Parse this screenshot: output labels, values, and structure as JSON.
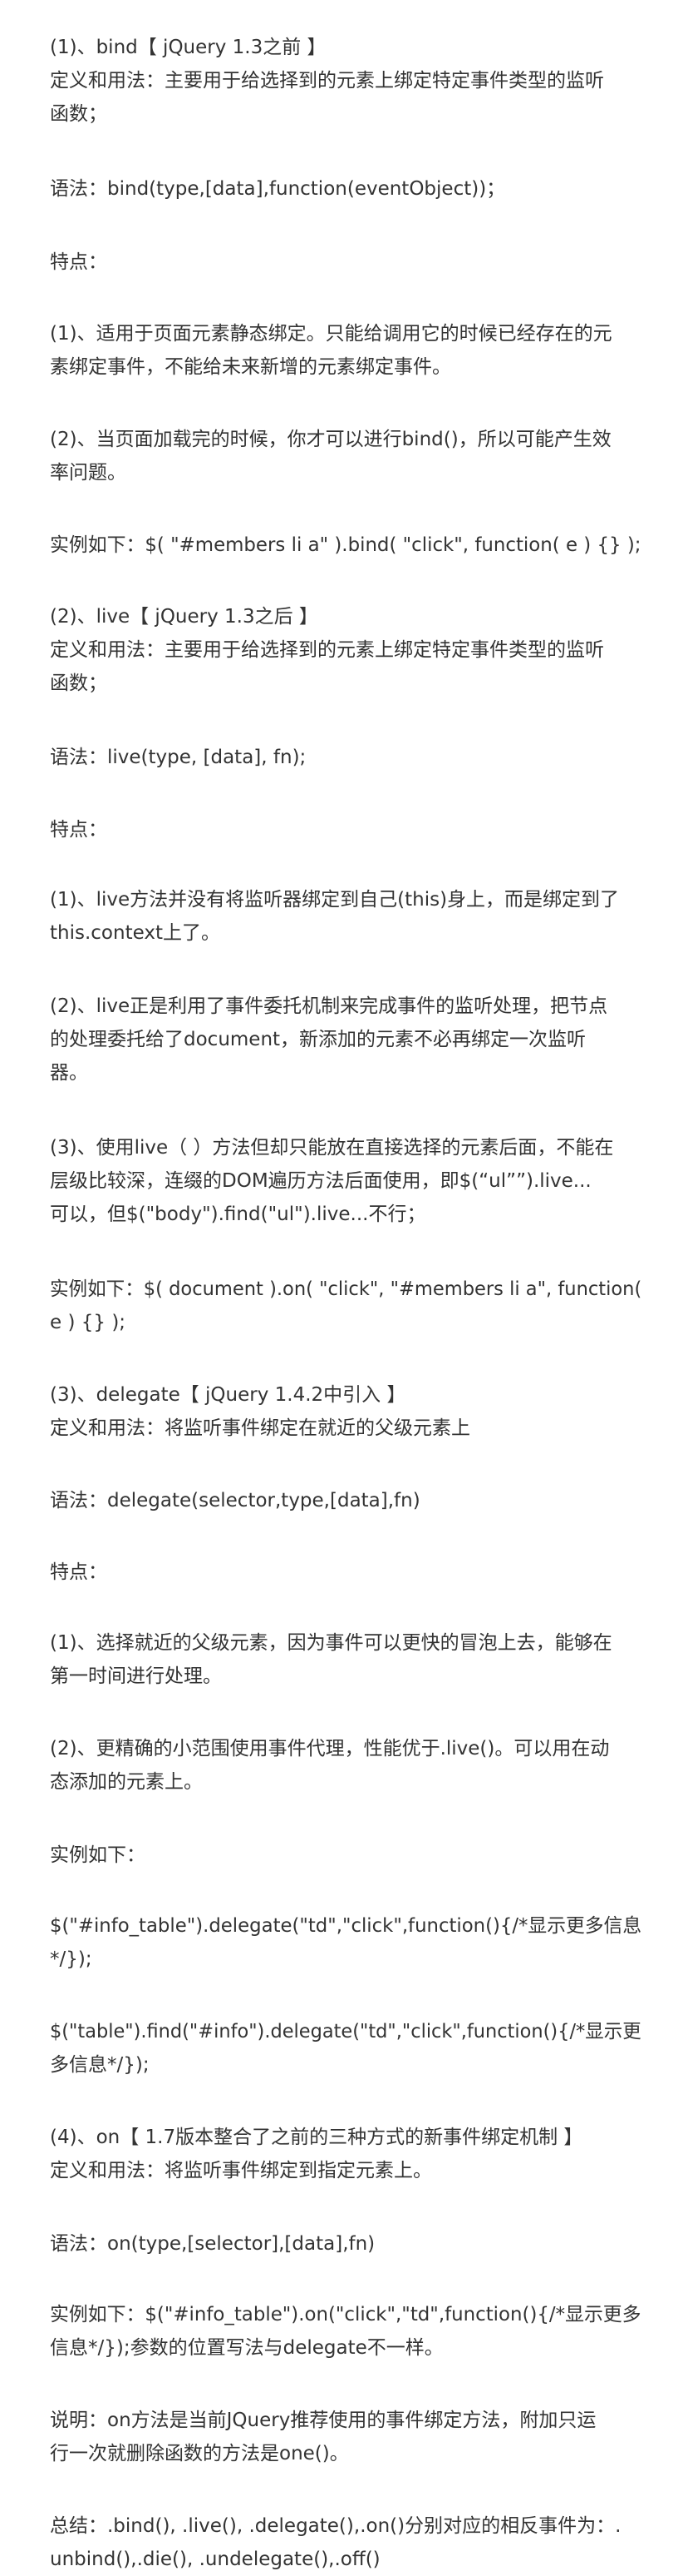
{
  "blocks": [
    {
      "id": "bind-heading",
      "lines": [
        "(1)、bind【 jQuery 1.3之前 】",
        "定义和用法：主要用于给选择到的元素上绑定特定事件类型的监听",
        "函数；"
      ]
    },
    {
      "id": "bind-syntax",
      "lines": [
        "语法：bind(type,[data],function(eventObject))；"
      ]
    },
    {
      "id": "bind-features-label",
      "lines": [
        "特点："
      ]
    },
    {
      "id": "bind-feature-1",
      "lines": [
        "(1)、适用于页面元素静态绑定。只能给调用它的时候已经存在的元",
        "素绑定事件，不能给未来新增的元素绑定事件。"
      ]
    },
    {
      "id": "bind-feature-2",
      "lines": [
        "(2)、当页面加载完的时候，你才可以进行bind()，所以可能产生效",
        "率问题。"
      ]
    },
    {
      "id": "bind-example",
      "lines": [
        "实例如下：$( \"#members li a\" ).bind( \"click\", function( e ) {} );"
      ]
    },
    {
      "id": "live-heading",
      "lines": [
        "(2)、live【 jQuery 1.3之后 】",
        "定义和用法：主要用于给选择到的元素上绑定特定事件类型的监听",
        "函数；"
      ]
    },
    {
      "id": "live-syntax",
      "lines": [
        "语法：live(type, [data], fn);"
      ]
    },
    {
      "id": "live-features-label",
      "lines": [
        "特点："
      ]
    },
    {
      "id": "live-feature-1",
      "lines": [
        "(1)、live方法并没有将监听器绑定到自己(this)身上，而是绑定到了",
        "this.context上了。"
      ]
    },
    {
      "id": "live-feature-2",
      "lines": [
        "(2)、live正是利用了事件委托机制来完成事件的监听处理，把节点",
        "的处理委托给了document，新添加的元素不必再绑定一次监听",
        "器。"
      ]
    },
    {
      "id": "live-feature-3",
      "lines": [
        "(3)、使用live（ ）方法但却只能放在直接选择的元素后面，不能在",
        "层级比较深，连缀的DOM遍历方法后面使用，即$(“ul””).live...",
        "可以，但$(\"body\").find(\"ul\").live...不行；"
      ]
    },
    {
      "id": "live-example",
      "lines": [
        "实例如下：$( document ).on( \"click\", \"#members li a\", function(",
        "e ) {} );"
      ]
    },
    {
      "id": "delegate-heading",
      "lines": [
        "(3)、delegate【 jQuery 1.4.2中引入 】",
        "定义和用法：将监听事件绑定在就近的父级元素上"
      ]
    },
    {
      "id": "delegate-syntax",
      "lines": [
        "语法：delegate(selector,type,[data],fn)"
      ]
    },
    {
      "id": "delegate-features-label",
      "lines": [
        "特点："
      ]
    },
    {
      "id": "delegate-feature-1",
      "lines": [
        "(1)、选择就近的父级元素，因为事件可以更快的冒泡上去，能够在",
        "第一时间进行处理。"
      ]
    },
    {
      "id": "delegate-feature-2",
      "lines": [
        "(2)、更精确的小范围使用事件代理，性能优于.live()。可以用在动",
        "态添加的元素上。"
      ]
    },
    {
      "id": "delegate-example-label",
      "lines": [
        "实例如下："
      ]
    },
    {
      "id": "delegate-example-1",
      "lines": [
        "$(\"#info_table\").delegate(\"td\",\"click\",function(){/*显示更多信息",
        "*/});"
      ]
    },
    {
      "id": "delegate-example-2",
      "lines": [
        "$(\"table\").find(\"#info\").delegate(\"td\",\"click\",function(){/*显示更",
        "多信息*/});"
      ]
    },
    {
      "id": "on-heading",
      "lines": [
        "(4)、on【 1.7版本整合了之前的三种方式的新事件绑定机制 】",
        "定义和用法：将监听事件绑定到指定元素上。"
      ]
    },
    {
      "id": "on-syntax",
      "lines": [
        "语法：on(type,[selector],[data],fn)"
      ]
    },
    {
      "id": "on-example",
      "lines": [
        "实例如下：$(\"#info_table\").on(\"click\",\"td\",function(){/*显示更多",
        "信息*/});参数的位置写法与delegate不一样。"
      ]
    },
    {
      "id": "on-note",
      "lines": [
        "说明：on方法是当前JQuery推荐使用的事件绑定方法，附加只运",
        "行一次就删除函数的方法是one()。"
      ]
    },
    {
      "id": "summary",
      "lines": [
        " 总结：.bind(), .live(), .delegate(),.on()分别对应的相反事件为：.",
        "unbind(),.die(), .undelegate(),.off()"
      ]
    }
  ]
}
